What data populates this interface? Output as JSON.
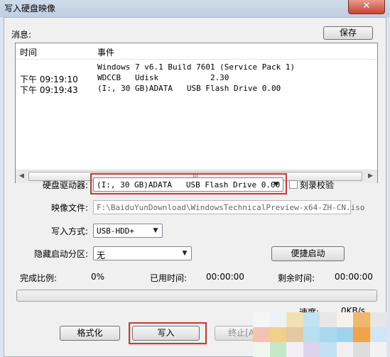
{
  "window": {
    "title": "写入硬盘映像",
    "close_icon": "✕"
  },
  "messages": {
    "label": "消息:",
    "save_label": "保存",
    "columns": [
      "时间",
      "事件"
    ],
    "rows": [
      {
        "time": "",
        "event": "Windows 7 v6.1 Build 7601 (Service Pack 1)"
      },
      {
        "time": "下午 09:19:10",
        "event": "WDCCB   Udisk           2.30"
      },
      {
        "time": "下午 09:19:43",
        "event": "(I:, 30 GB)ADATA   USB Flash Drive 0.00"
      }
    ],
    "scroll_grip": "III"
  },
  "form": {
    "drive_label": "硬盘驱动器:",
    "drive_value": "(I:, 30 GB)ADATA   USB Flash Drive 0.00",
    "verify_label": "刻录校验",
    "verify_checked": false,
    "image_label": "映像文件:",
    "image_value": "F:\\BaiduYunDownload\\WindowsTechnicalPreview-x64-ZH-CN.iso",
    "write_mode_label": "写入方式:",
    "write_mode_value": "USB-HDD+",
    "hide_partition_label": "隐藏启动分区:",
    "hide_partition_value": "无",
    "quick_boot_label": "便捷启动"
  },
  "status": {
    "percent_label": "完成比例:",
    "percent_value": "0%",
    "elapsed_label": "已用时间:",
    "elapsed_value": "00:00:00",
    "remaining_label": "剩余时间:",
    "remaining_value": "00:00:00",
    "progress_fraction": 0,
    "speed_label": "速度:",
    "speed_value": "0KB/s"
  },
  "actions": {
    "format_label": "格式化",
    "write_label": "写入",
    "abort_label": "终止[A]"
  },
  "colors": {
    "highlight_red": "#e0312b"
  }
}
